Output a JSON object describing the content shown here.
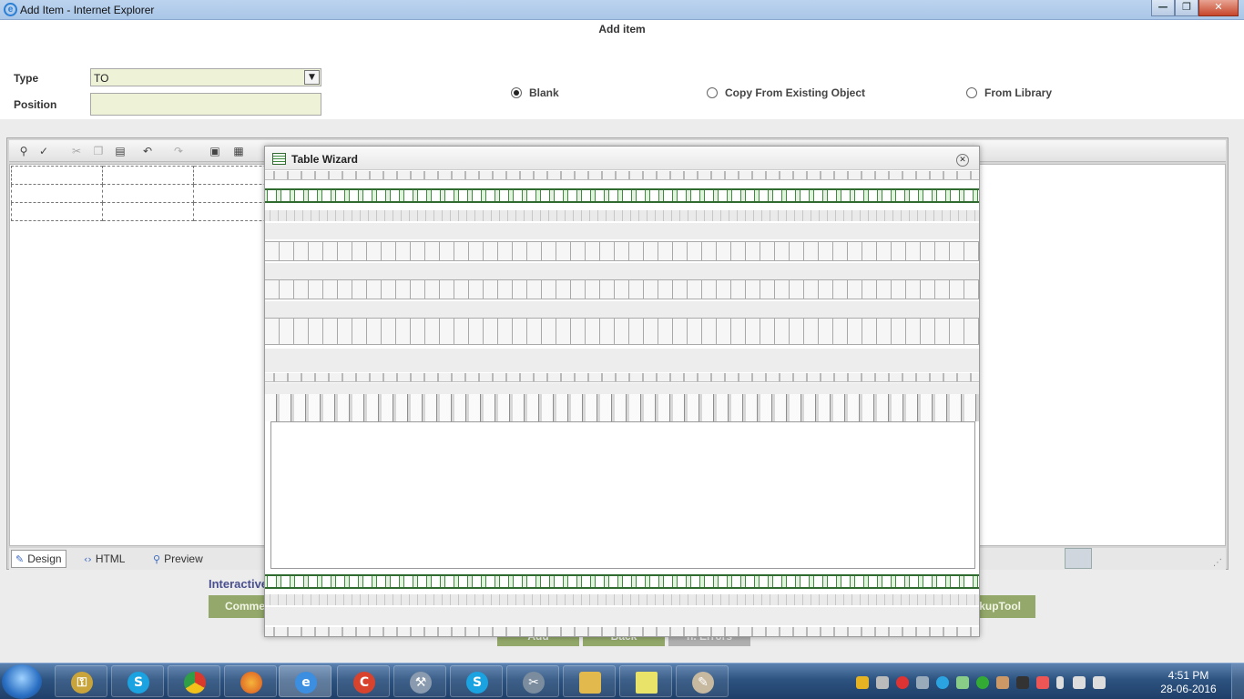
{
  "window": {
    "title": "Add Item - Internet Explorer",
    "minimize": "—",
    "maximize": "❐",
    "close": "✕"
  },
  "form": {
    "heading": "Add item",
    "type_label": "Type",
    "type_value": "TO",
    "position_label": "Position",
    "position_value": "",
    "radios": [
      {
        "label": "Blank",
        "checked": true
      },
      {
        "label": "Copy From Existing Object",
        "checked": false
      },
      {
        "label": "From Library",
        "checked": false
      }
    ]
  },
  "editor": {
    "modes": [
      {
        "label": "Design",
        "icon": "pencil-icon"
      },
      {
        "label": "HTML",
        "icon": "code-icon"
      },
      {
        "label": "Preview",
        "icon": "magnifier-icon"
      }
    ]
  },
  "lower": {
    "interactive_label": "Interactive",
    "green_bar_left": "Comment",
    "green_bar_right": "arkupTool",
    "buttons": [
      "Add",
      "Back",
      "n. Errors"
    ]
  },
  "modal": {
    "title": "Table Wizard",
    "close_glyph": "✕"
  },
  "taskbar": {
    "time": "4:51 PM",
    "date": "28-06-2016"
  },
  "colors": {
    "accent_green": "#93a86a",
    "field_bg": "#eef3d8",
    "label_purple": "#4a4f8f"
  }
}
